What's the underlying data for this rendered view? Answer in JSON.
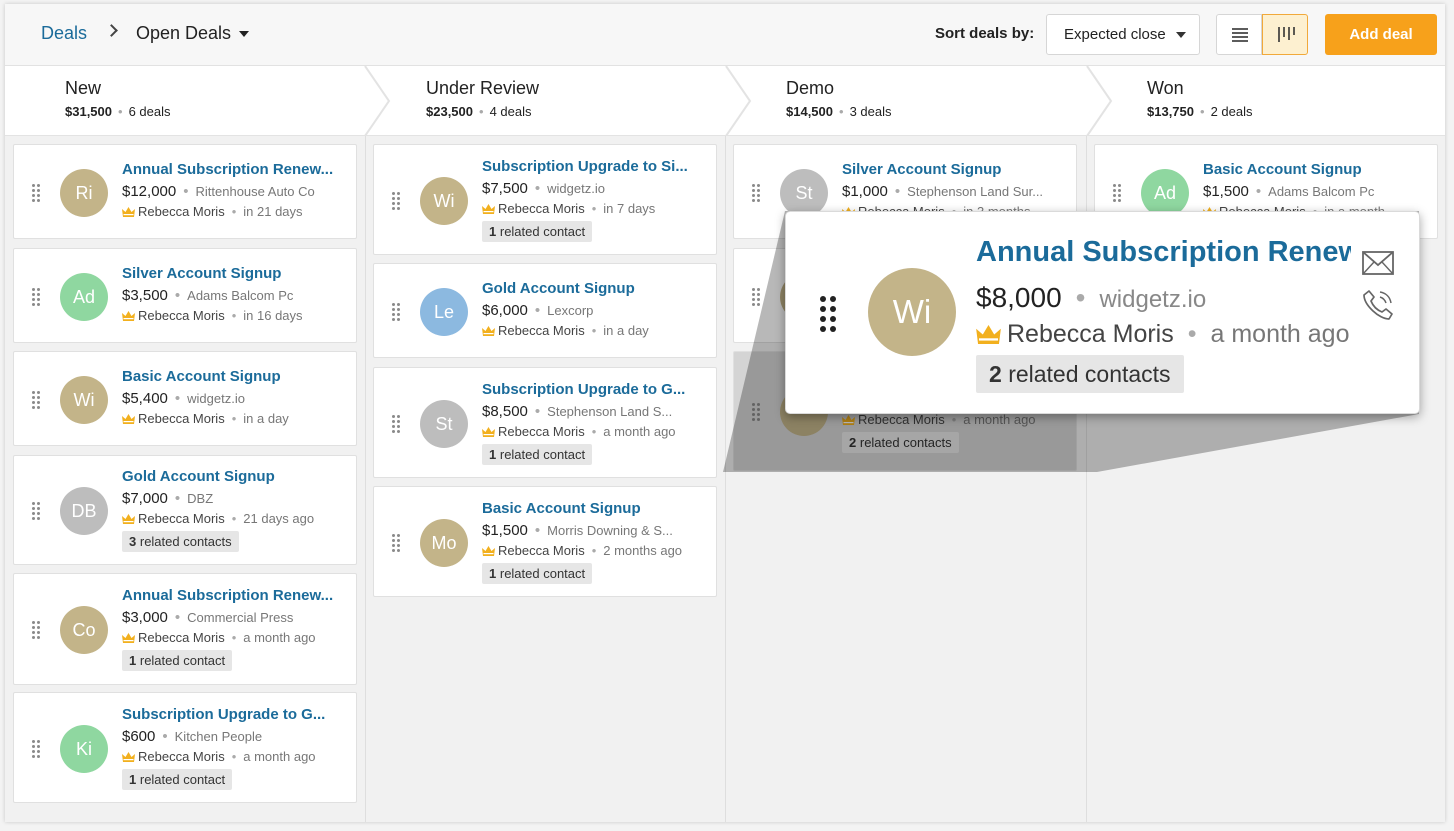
{
  "header": {
    "breadcrumb_root": "Deals",
    "breadcrumb_current": "Open Deals",
    "sort_label": "Sort deals by:",
    "sort_value": "Expected close",
    "add_deal": "Add deal"
  },
  "colors": {
    "accent": "#f7a11b",
    "link": "#1b6b9a",
    "crown": "#f2b01e",
    "avatar_tan": "#c3b489",
    "avatar_green": "#8fd7a0",
    "avatar_blue": "#8cb9e0",
    "avatar_gray": "#bdbdbd"
  },
  "stages": [
    {
      "name": "New",
      "amount": "$31,500",
      "count": "6 deals"
    },
    {
      "name": "Under Review",
      "amount": "$23,500",
      "count": "4 deals"
    },
    {
      "name": "Demo",
      "amount": "$14,500",
      "count": "3 deals"
    },
    {
      "name": "Won",
      "amount": "$13,750",
      "count": "2 deals"
    }
  ],
  "columns": [
    {
      "cards": [
        {
          "initials": "Ri",
          "title": "Annual Subscription Renew...",
          "amount": "$12,000",
          "company": "Rittenhouse Auto Co",
          "owner": "Rebecca Moris",
          "when": "in 21 days",
          "related_count": "",
          "related_label": ""
        },
        {
          "initials": "Ad",
          "title": "Silver Account Signup",
          "amount": "$3,500",
          "company": "Adams Balcom Pc",
          "owner": "Rebecca Moris",
          "when": "in 16 days",
          "related_count": "",
          "related_label": ""
        },
        {
          "initials": "Wi",
          "title": "Basic Account Signup",
          "amount": "$5,400",
          "company": "widgetz.io",
          "owner": "Rebecca Moris",
          "when": "in a day",
          "related_count": "",
          "related_label": ""
        },
        {
          "initials": "DB",
          "title": "Gold Account Signup",
          "amount": "$7,000",
          "company": "DBZ",
          "owner": "Rebecca Moris",
          "when": "21 days ago",
          "related_count": "3",
          "related_label": "related contacts"
        },
        {
          "initials": "Co",
          "title": "Annual Subscription Renew...",
          "amount": "$3,000",
          "company": "Commercial Press",
          "owner": "Rebecca Moris",
          "when": "a month ago",
          "related_count": "1",
          "related_label": "related contact"
        },
        {
          "initials": "Ki",
          "title": "Subscription Upgrade to G...",
          "amount": "$600",
          "company": "Kitchen People",
          "owner": "Rebecca Moris",
          "when": "a month ago",
          "related_count": "1",
          "related_label": "related contact"
        }
      ]
    },
    {
      "cards": [
        {
          "initials": "Wi",
          "title": "Subscription Upgrade to Si...",
          "amount": "$7,500",
          "company": "widgetz.io",
          "owner": "Rebecca Moris",
          "when": "in 7 days",
          "related_count": "1",
          "related_label": "related contact"
        },
        {
          "initials": "Le",
          "title": "Gold Account Signup",
          "amount": "$6,000",
          "company": "Lexcorp",
          "owner": "Rebecca Moris",
          "when": "in a day",
          "related_count": "",
          "related_label": ""
        },
        {
          "initials": "St",
          "title": "Subscription Upgrade to G...",
          "amount": "$8,500",
          "company": "Stephenson Land S...",
          "owner": "Rebecca Moris",
          "when": "a month ago",
          "related_count": "1",
          "related_label": "related contact"
        },
        {
          "initials": "Mo",
          "title": "Basic Account Signup",
          "amount": "$1,500",
          "company": "Morris Downing & S...",
          "owner": "Rebecca Moris",
          "when": "2 months ago",
          "related_count": "1",
          "related_label": "related contact"
        }
      ]
    },
    {
      "cards": [
        {
          "initials": "St",
          "title": "Silver Account Signup",
          "amount": "$1,000",
          "company": "Stephenson Land Sur...",
          "owner": "Rebecca Moris",
          "when": "in 3 months",
          "related_count": "",
          "related_label": ""
        },
        {
          "initials": "",
          "title": "",
          "amount": "",
          "company": "",
          "owner": "",
          "when": "",
          "related_count": "",
          "related_label": ""
        },
        {
          "initials": "",
          "title": "",
          "amount": "",
          "company": "",
          "owner": "Rebecca Moris",
          "when": "a month ago",
          "related_count": "2",
          "related_label": "related contacts"
        }
      ]
    },
    {
      "cards": [
        {
          "initials": "Ad",
          "title": "Basic Account Signup",
          "amount": "$1,500",
          "company": "Adams Balcom Pc",
          "owner": "Rebecca Moris",
          "when": "in a month",
          "related_count": "",
          "related_label": ""
        }
      ]
    }
  ],
  "zoom": {
    "initials": "Wi",
    "title": "Annual Subscription Renew...",
    "amount": "$8,000",
    "company": "widgetz.io",
    "owner": "Rebecca Moris",
    "when": "a month ago",
    "related_count": "2",
    "related_label": "related contacts",
    "icons": [
      "email-icon",
      "phone-icon"
    ]
  }
}
